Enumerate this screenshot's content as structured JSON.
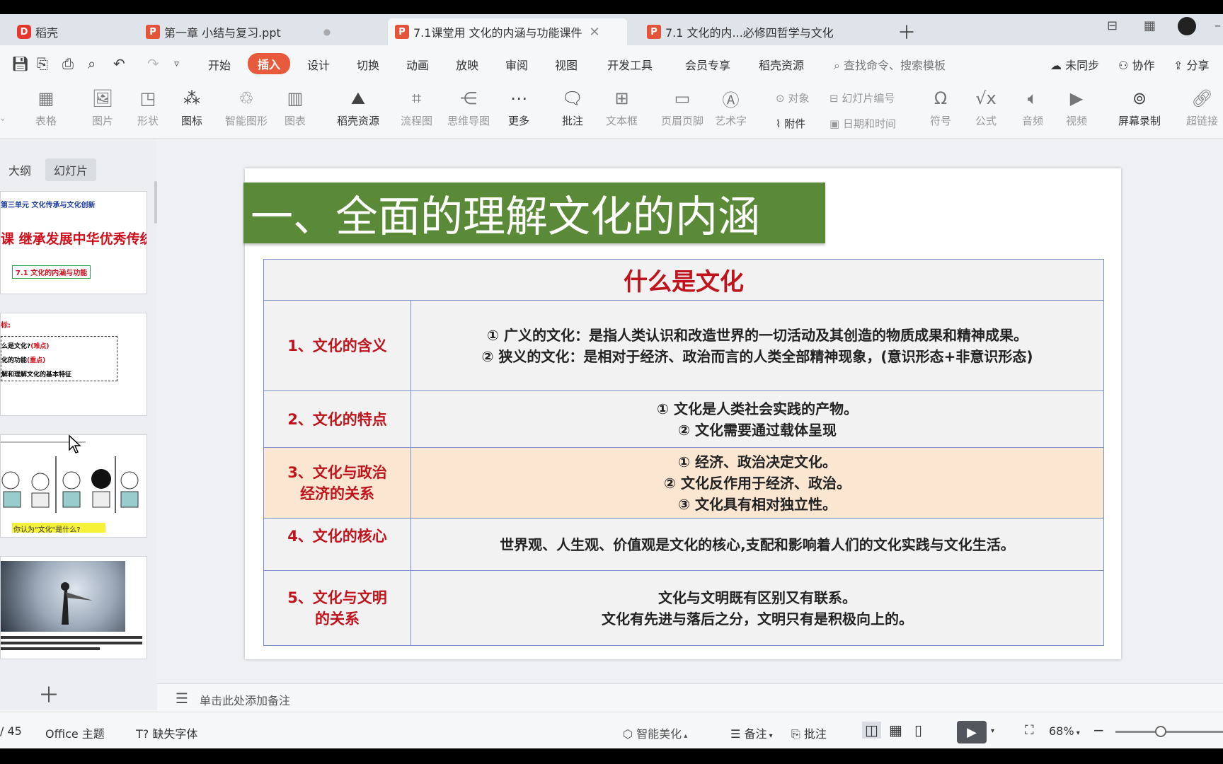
{
  "tabs": [
    {
      "label": "稻壳",
      "icon": "daoke-icon"
    },
    {
      "label": "第一章 小结与复习.ppt",
      "icon": "ppt-file-icon"
    },
    {
      "label": "7.1课堂用 文化的内涵与功能课件",
      "icon": "ppt-file-icon"
    },
    {
      "label": "7.1 文化的内...必修四哲学与文化",
      "icon": "ppt-file-icon"
    }
  ],
  "menu": [
    "开始",
    "插入",
    "设计",
    "切换",
    "动画",
    "放映",
    "审阅",
    "视图",
    "开发工具",
    "会员专享",
    "稻壳资源"
  ],
  "menu_active": "插入",
  "search_placeholder": "查找命令、搜索模板",
  "right_actions": {
    "sync": "未同步",
    "collab": "协作",
    "share": "分享"
  },
  "ribbon": {
    "table": "表格",
    "image": "图片",
    "shape": "形状",
    "icons": "图标",
    "smartart": "智能图形",
    "chart": "图表",
    "docer": "稻壳资源",
    "flow": "流程图",
    "mindmap": "思维导图",
    "more": "更多",
    "comment": "批注",
    "textbox": "文本框",
    "header_footer": "页眉页脚",
    "wordart": "艺术字",
    "object": "对象",
    "attachment": "附件",
    "slide_number": "幻灯片编号",
    "datetime": "日期和时间",
    "symbol": "符号",
    "formula": "公式",
    "audio": "音频",
    "video": "视频",
    "screen_record": "屏幕录制",
    "hyperlink": "超链接"
  },
  "panel_tabs": {
    "outline": "大纲",
    "slides": "幻灯片"
  },
  "thumbs": {
    "t1_header": "第三单元  文化传承与文化创新",
    "t1_title": "课  继承发展中华优秀传统文化",
    "t1_sub": "7.1  文化的内涵与功能",
    "t2_label": "标:",
    "t2_lines": [
      {
        "a": "么是文化?",
        "b": "(难点)"
      },
      {
        "a": "化的功能",
        "b": "(重点)"
      },
      {
        "a": "解和理解文化的基本特征",
        "b": ""
      }
    ],
    "t3_caption": "你认为\"文化\"是什么?"
  },
  "slide": {
    "title": "一、全面的理解文化的内涵",
    "table_header": "什么是文化",
    "rows": [
      {
        "key": "1、文化的含义",
        "lines": [
          "① 广义的文化：是指人类认识和改造世界的一切活动及其创造的物质成果和精神成果。",
          "② 狭义的文化：是相对于经济、政治而言的人类全部精神现象，(意识形态+非意识形态)"
        ]
      },
      {
        "key": "2、文化的特点",
        "lines": [
          "① 文化是人类社会实践的产物。",
          "② 文化需要通过载体呈现"
        ]
      },
      {
        "key_lines": [
          "3、文化与政治",
          "经济的关系"
        ],
        "lines": [
          "① 经济、政治决定文化。",
          "② 文化反作用于经济、政治。",
          "③ 文化具有相对独立性。"
        ]
      },
      {
        "key": "4、文化的核心",
        "lines": [
          "世界观、人生观、价值观是文化的核心,支配和影响着人们的文化实践与文化生活。"
        ]
      },
      {
        "key_lines": [
          "5、文化与文明",
          "的关系"
        ],
        "lines": [
          "文化与文明既有区别又有联系。",
          "文化有先进与落后之分，文明只有是积极向上的。"
        ]
      }
    ]
  },
  "notes_placeholder": "单击此处添加备注",
  "status": {
    "page": "/ 45",
    "theme": "Office 主题",
    "missing_font": "缺失字体",
    "beautify": "智能美化",
    "notes": "备注",
    "comment": "批注",
    "zoom": "68%"
  },
  "colors": {
    "accent": "#e85a3c",
    "title_green": "#5a8a37",
    "table_red": "#c0141c",
    "row3_bg": "#fbe6d2"
  }
}
